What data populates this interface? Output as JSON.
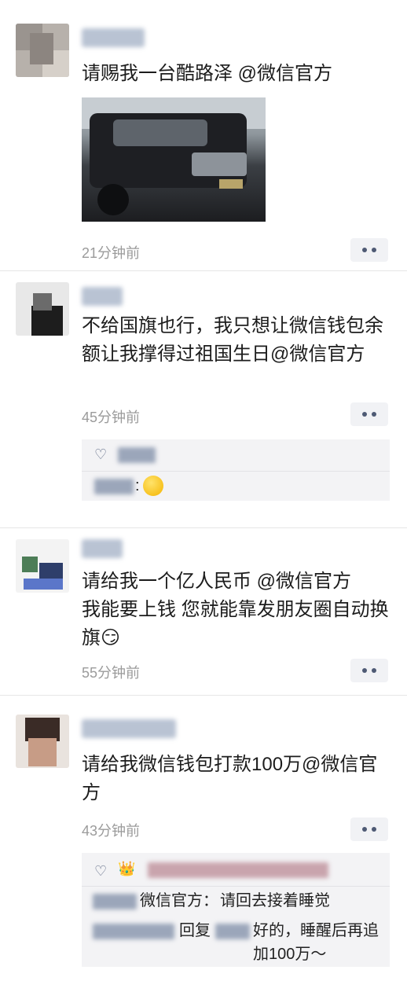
{
  "posts": [
    {
      "content": "请赐我一台酷路泽 @微信官方",
      "time": "21分钟前",
      "image": "car-photo"
    },
    {
      "content": "不给国旗也行，我只想让微信钱包余额让我撑得过祖国生日@微信官方",
      "time": "45分钟前"
    },
    {
      "content": "请给我一个亿人民币 @微信官方\n我能要上钱 您就能靠发朋友圈自动换旗😏",
      "time": "55分钟前"
    },
    {
      "content": "请给我微信钱包打款100万@微信官方",
      "time": "43分钟前",
      "comments": [
        {
          "label": "微信官方：",
          "text": "请回去接着睡觉"
        },
        {
          "label": "回复",
          "text": "好的，睡醒后再追加100万～"
        }
      ]
    }
  ],
  "icons": {
    "heart": "♡",
    "like_crown": "👑",
    "more_menu": "two-dots"
  }
}
